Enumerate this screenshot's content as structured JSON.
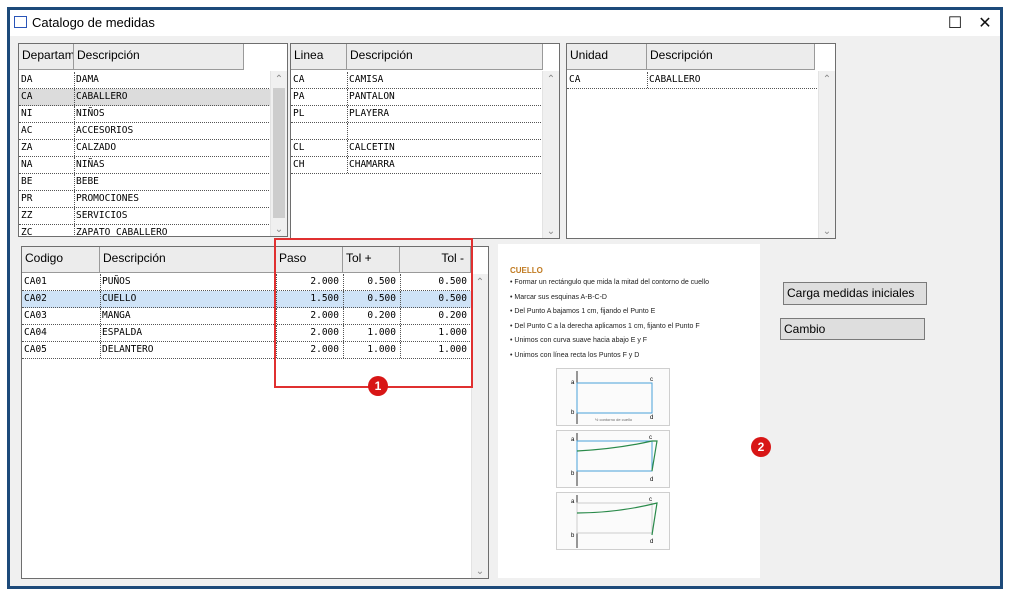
{
  "window": {
    "title": "Catalogo de medidas",
    "maximize_glyph": "☐",
    "close_glyph": "✕"
  },
  "departamentos": {
    "headers": [
      "Departam",
      "Descripción"
    ],
    "rows": [
      [
        "DA",
        "DAMA"
      ],
      [
        "CA",
        "CABALLERO"
      ],
      [
        "NI",
        "NIÑOS"
      ],
      [
        "AC",
        "ACCESORIOS"
      ],
      [
        "ZA",
        "CALZADO"
      ],
      [
        "NA",
        "NIÑAS"
      ],
      [
        "BE",
        "BEBE"
      ],
      [
        "PR",
        "PROMOCIONES"
      ],
      [
        "ZZ",
        "SERVICIOS"
      ],
      [
        "ZC",
        "ZAPATO CABALLERO"
      ]
    ],
    "selected_index": 1
  },
  "lineas": {
    "headers": [
      "Linea",
      "Descripción"
    ],
    "rows": [
      [
        "CA",
        "CAMISA"
      ],
      [
        "PA",
        "PANTALON"
      ],
      [
        "PL",
        "PLAYERA"
      ],
      [
        "",
        ""
      ],
      [
        "CL",
        "CALCETIN"
      ],
      [
        "CH",
        "CHAMARRA"
      ]
    ]
  },
  "unidades": {
    "headers": [
      "Unidad",
      "Descripción"
    ],
    "rows": [
      [
        "CA",
        "CABALLERO"
      ]
    ]
  },
  "medidas": {
    "headers": [
      "Codigo",
      "Descripción",
      "Paso",
      "Tol +",
      "Tol -"
    ],
    "rows": [
      [
        "CA01",
        "PUÑOS",
        "2.000",
        "0.500",
        "0.500"
      ],
      [
        "CA02",
        "CUELLO",
        "1.500",
        "0.500",
        "0.500"
      ],
      [
        "CA03",
        "MANGA",
        "2.000",
        "0.200",
        "0.200"
      ],
      [
        "CA04",
        "ESPALDA",
        "2.000",
        "1.000",
        "1.000"
      ],
      [
        "CA05",
        "DELANTERO",
        "2.000",
        "1.000",
        "1.000"
      ]
    ],
    "selected_index": 1
  },
  "instructions": {
    "title": "CUELLO",
    "steps": [
      "Formar un rectángulo que mida la mitad del contorno de cuello",
      "Marcar sus esquinas A-B-C-D",
      "Del Punto A bajamos 1 cm, fijando el Punto E",
      "Del Punto C a la derecha aplicamos 1 cm, fijanto el Punto F",
      "Unimos con curva suave hacia abajo E y F",
      "Unimos con línea recta los Puntos F y D"
    ],
    "figure_caption": "½ contorno de cuello"
  },
  "buttons": {
    "carga": "Carga medidas iniciales",
    "cambio": "Cambio"
  },
  "annotations": {
    "badge1": "1",
    "badge2": "2",
    "color": "#d81616"
  },
  "icons": {
    "scroll_up": "⌃",
    "scroll_down": "⌄"
  }
}
